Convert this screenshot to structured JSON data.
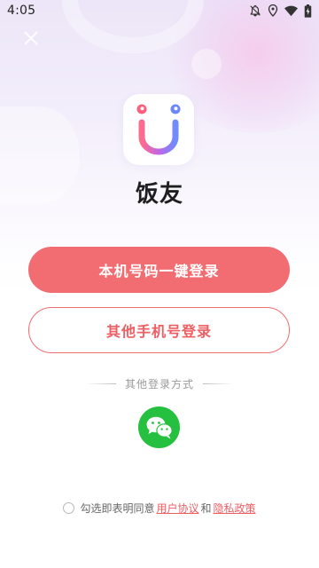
{
  "status_bar": {
    "time": "4:05",
    "icons": [
      "bell-off-icon",
      "location-icon",
      "wifi-icon",
      "battery-icon"
    ]
  },
  "header": {
    "close_icon": "close-icon"
  },
  "app": {
    "name": "饭友",
    "logo_icon": "app-logo-icon"
  },
  "actions": {
    "one_click_login_label": "本机号码一键登录",
    "other_phone_login_label": "其他手机号登录"
  },
  "other_login": {
    "divider_text": "其他登录方式",
    "methods": [
      {
        "icon": "wechat-icon"
      }
    ]
  },
  "agreement": {
    "prefix": "勾选即表明同意",
    "user_agreement": "用户协议",
    "conjunction": "和",
    "privacy_policy": "隐私政策",
    "checked": false
  },
  "colors": {
    "primary": "#f16d71",
    "primary_text": "#ee5e63",
    "wechat_green": "#25c03f",
    "background_top": "#ece6f8"
  }
}
